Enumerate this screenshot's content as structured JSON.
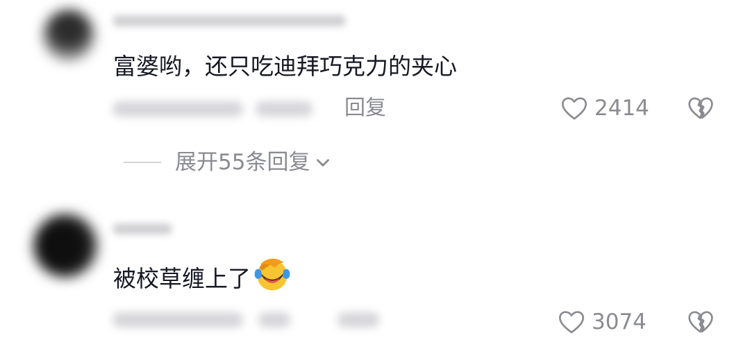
{
  "comments": [
    {
      "text": "富婆哟，还只吃迪拜巧克力的夹心",
      "reply_label": "回复",
      "like_count": "2414",
      "like_icon": "heart-outline-icon",
      "dislike_icon": "broken-heart-icon",
      "replies_toggle": "展开55条回复",
      "toggle_icon": "chevron-down-icon"
    },
    {
      "text": "被校草缠上了",
      "emoji": "face-palm-laughing-emoji",
      "like_count": "3074",
      "like_icon": "heart-outline-icon",
      "dislike_icon": "broken-heart-icon"
    }
  ],
  "colors": {
    "text": "#161823",
    "secondary": "#8a8b91",
    "divider": "#d3d4d8",
    "emoji_yellow": "#f7c531",
    "emoji_blue": "#3d97e8"
  }
}
